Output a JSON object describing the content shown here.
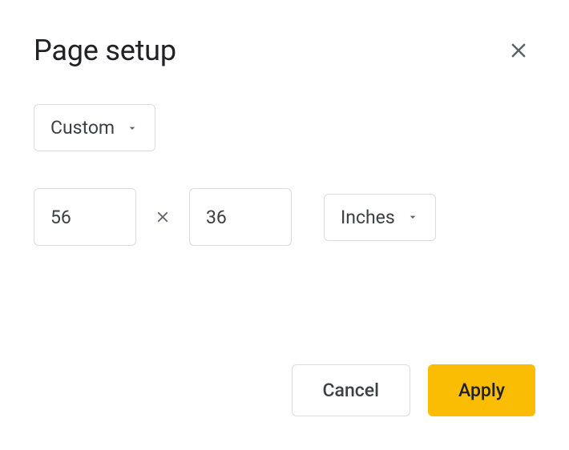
{
  "dialog": {
    "title": "Page setup"
  },
  "preset": {
    "label": "Custom"
  },
  "dimensions": {
    "width": "56",
    "height": "36"
  },
  "units": {
    "label": "Inches"
  },
  "buttons": {
    "cancel": "Cancel",
    "apply": "Apply"
  }
}
